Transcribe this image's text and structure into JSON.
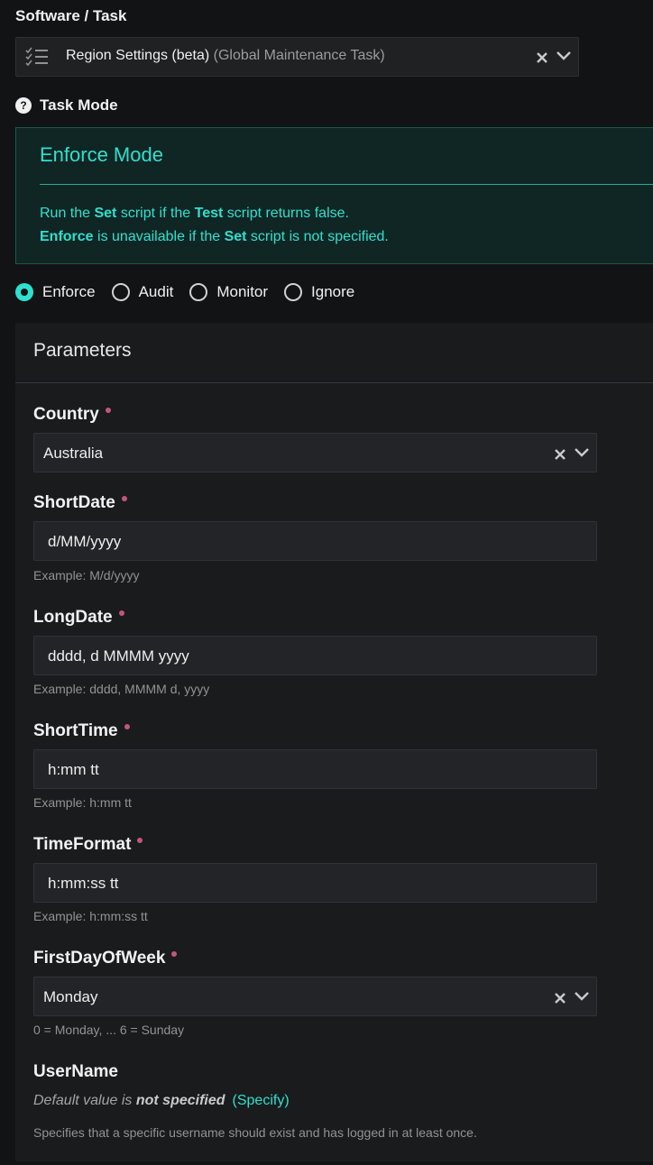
{
  "software_task": {
    "label": "Software / Task",
    "task_name": "Region Settings (beta)",
    "task_scope": "(Global Maintenance Task)"
  },
  "task_mode": {
    "label": "Task Mode",
    "help_glyph": "?",
    "box_title": "Enforce Mode",
    "line1": {
      "a": "Run the ",
      "b": "Set",
      "c": " script if the ",
      "d": "Test",
      "e": " script returns false."
    },
    "line2": {
      "a": "Enforce",
      "b": " is unavailable if the ",
      "c": "Set",
      "d": " script is not specified."
    },
    "options": [
      "Enforce",
      "Audit",
      "Monitor",
      "Ignore"
    ],
    "selected": "Enforce"
  },
  "parameters": {
    "title": "Parameters",
    "country": {
      "label": "Country",
      "value": "Australia"
    },
    "short_date": {
      "label": "ShortDate",
      "value": "d/MM/yyyy",
      "hint": "Example: M/d/yyyy"
    },
    "long_date": {
      "label": "LongDate",
      "value": "dddd, d MMMM yyyy",
      "hint": "Example: dddd, MMMM d, yyyy"
    },
    "short_time": {
      "label": "ShortTime",
      "value": "h:mm tt",
      "hint": "Example: h:mm tt"
    },
    "time_format": {
      "label": "TimeFormat",
      "value": "h:mm:ss tt",
      "hint": "Example: h:mm:ss tt"
    },
    "first_day": {
      "label": "FirstDayOfWeek",
      "value": "Monday",
      "hint": "0 = Monday, ... 6 = Sunday"
    },
    "username": {
      "label": "UserName",
      "default_prefix": "Default value is ",
      "default_value": "not specified",
      "specify_link": "(Specify)",
      "description": "Specifies that a specific username should exist and has logged in at least once."
    }
  },
  "icons": {
    "task": "checklist-icon",
    "clear": "clear-icon",
    "dropdown": "chevron-down-icon",
    "help": "help-icon"
  },
  "colors": {
    "accent": "#2ee0cf",
    "required_dot": "#c2577a",
    "background": "#121314"
  }
}
